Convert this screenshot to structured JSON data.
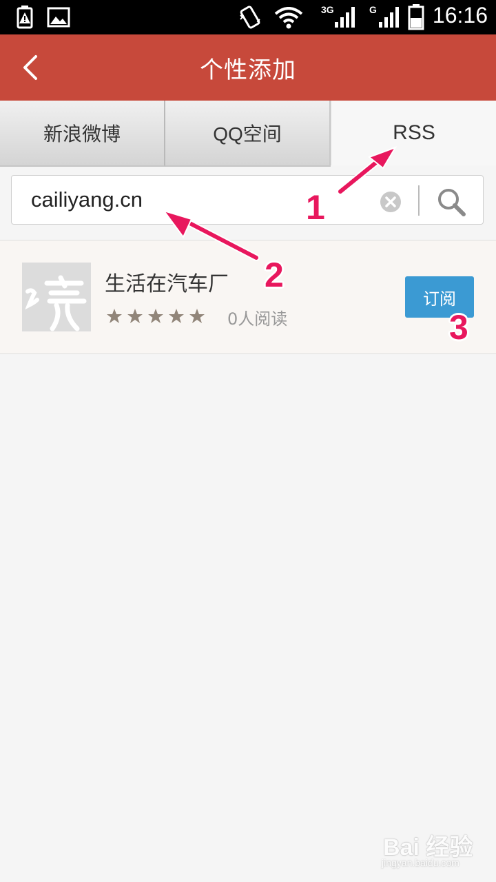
{
  "status_bar": {
    "time": "16:16",
    "net_3g": "3G",
    "net_g": "G",
    "icons": [
      "battery-warning-icon",
      "image-icon",
      "vibrate-icon",
      "wifi-icon",
      "signal-3g-icon",
      "signal-g-icon",
      "battery-icon"
    ]
  },
  "header": {
    "title": "个性添加",
    "back_icon": "chevron-left-icon",
    "bg_color": "#c7493b"
  },
  "tabs": [
    {
      "label": "新浪微博",
      "selected": false
    },
    {
      "label": "QQ空间",
      "selected": false
    },
    {
      "label": "RSS",
      "selected": true
    }
  ],
  "search": {
    "value": "cailiyang.cn",
    "clear_icon": "clear-circle-icon",
    "search_icon": "search-icon"
  },
  "results": [
    {
      "title": "生活在汽车厂",
      "thumb_text": "读",
      "rating": 5,
      "readers": "0人阅读",
      "subscribe_label": "订阅",
      "button_color": "#3b9ad3"
    }
  ],
  "annotations": {
    "n1": "1",
    "n2": "2",
    "n3": "3",
    "color": "#e8175d"
  },
  "watermark": {
    "main": "Bai 经验",
    "sub": "jingyan.baidu.com"
  }
}
